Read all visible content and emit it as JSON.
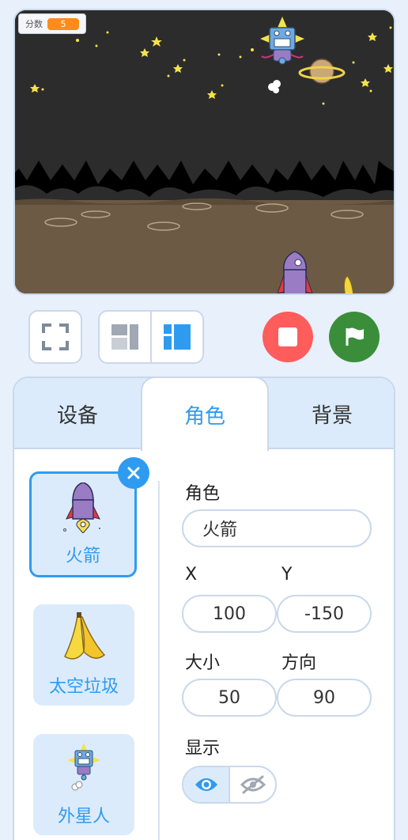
{
  "stage": {
    "score_label": "分数",
    "score_value": "5"
  },
  "tabs": [
    {
      "label": "设备",
      "active": false
    },
    {
      "label": "角色",
      "active": true
    },
    {
      "label": "背景",
      "active": false
    }
  ],
  "sprites": [
    {
      "name": "火箭",
      "selected": true
    },
    {
      "name": "太空垃圾",
      "selected": false
    },
    {
      "name": "外星人",
      "selected": false
    }
  ],
  "properties": {
    "sprite_label": "角色",
    "sprite_name": "火箭",
    "x_label": "X",
    "x_value": "100",
    "y_label": "Y",
    "y_value": "-150",
    "size_label": "大小",
    "size_value": "50",
    "direction_label": "方向",
    "direction_value": "90",
    "show_label": "显示"
  },
  "colors": {
    "accent": "#2f9bf0",
    "stop": "#ff5c5c",
    "go": "#3a8e3a",
    "score": "#ff8c1a"
  }
}
